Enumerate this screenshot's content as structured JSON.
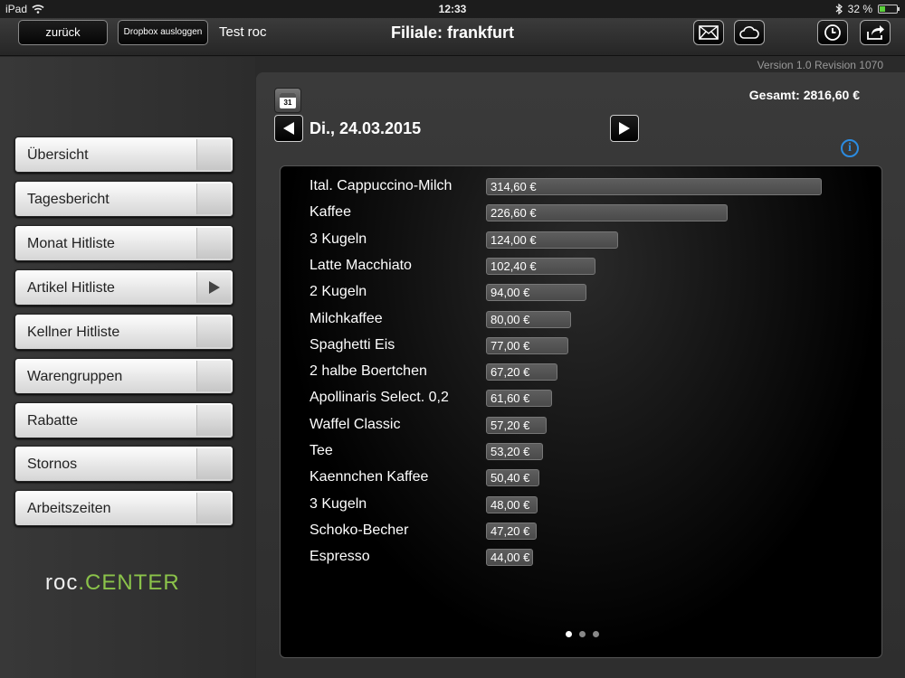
{
  "status": {
    "device": "iPad",
    "time": "12:33",
    "battery": "32 %",
    "battery_level": 0.32
  },
  "nav": {
    "back_label": "zurück",
    "dropbox_label": "Dropbox ausloggen",
    "user": "Test roc",
    "title": "Filiale: frankfurt",
    "icons": [
      "mail-icon",
      "cloud-icon",
      "clock-icon",
      "share-icon"
    ]
  },
  "version": "Version 1.0 Revision 1070",
  "sidebar": {
    "items": [
      {
        "label": "Übersicht",
        "active": false
      },
      {
        "label": "Tagesbericht",
        "active": false
      },
      {
        "label": "Monat Hitliste",
        "active": false
      },
      {
        "label": "Artikel Hitliste",
        "active": true
      },
      {
        "label": "Kellner Hitliste",
        "active": false
      },
      {
        "label": "Warengruppen",
        "active": false
      },
      {
        "label": "Rabatte",
        "active": false
      },
      {
        "label": "Stornos",
        "active": false
      },
      {
        "label": "Arbeitszeiten",
        "active": false
      }
    ],
    "logo_main": "roc",
    "logo_accent": "CENTER"
  },
  "main": {
    "calendar_day": "31",
    "date": "Di., 24.03.2015",
    "total": "Gesamt: 2816,60 €",
    "info": "i"
  },
  "chart_data": {
    "type": "bar",
    "orientation": "horizontal",
    "categories": [
      "Ital. Cappuccino-Milch",
      "Kaffee",
      "3 Kugeln",
      "Latte Macchiato",
      "2 Kugeln",
      "Milchkaffee",
      "Spaghetti Eis",
      "2 halbe Boertchen",
      "Apollinaris Select. 0,2",
      "Waffel Classic",
      "Tee",
      "Kaennchen Kaffee",
      "3 Kugeln",
      "Schoko-Becher",
      "Espresso"
    ],
    "values": [
      314.6,
      226.6,
      124.0,
      102.4,
      94.0,
      80.0,
      77.0,
      67.2,
      61.6,
      57.2,
      53.2,
      50.4,
      48.0,
      47.2,
      44.0
    ],
    "labels": [
      "314,60 €",
      "226,60 €",
      "124,00 €",
      "102,40 €",
      "94,00 €",
      "80,00 €",
      "77,00 €",
      "67,20 €",
      "61,60 €",
      "57,20 €",
      "53,20 €",
      "50,40 €",
      "48,00 €",
      "47,20 €",
      "44,00 €"
    ],
    "pages": 3,
    "current_page": 0
  }
}
